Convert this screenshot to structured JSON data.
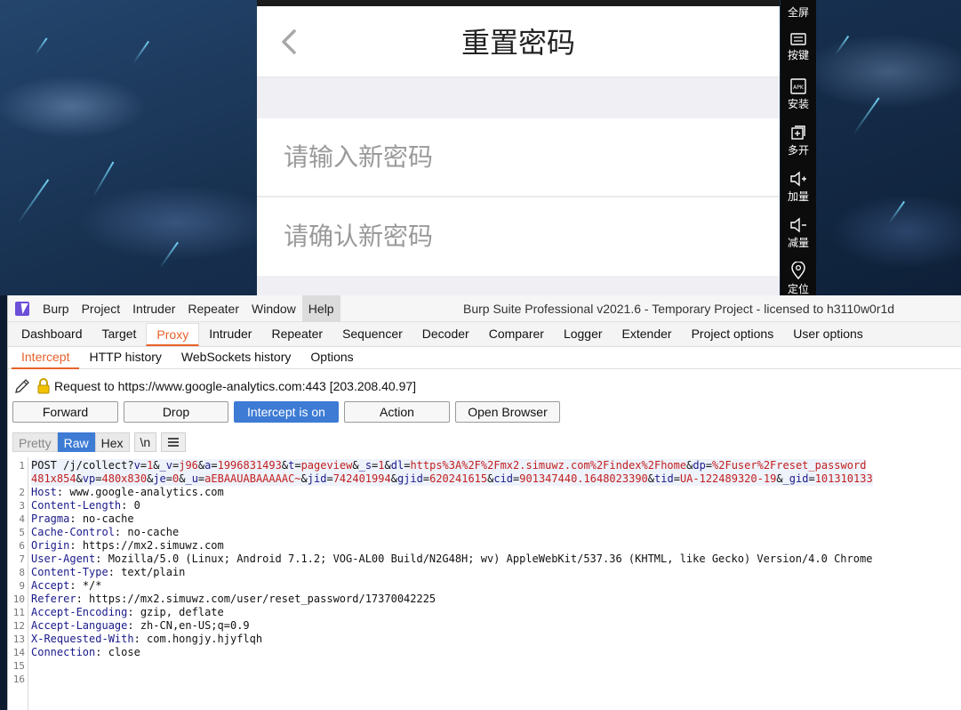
{
  "phone": {
    "title": "重置密码",
    "new_password_placeholder": "请输入新密码",
    "confirm_password_placeholder": "请确认新密码"
  },
  "emulator_toolbar": {
    "items": [
      {
        "label": "全屏",
        "icon": "fullscreen-icon"
      },
      {
        "label": "按键",
        "icon": "keyboard-icon"
      },
      {
        "label": "安装",
        "icon": "apk-icon"
      },
      {
        "label": "多开",
        "icon": "multi-instance-icon"
      },
      {
        "label": "加量",
        "icon": "volume-up-icon"
      },
      {
        "label": "减量",
        "icon": "volume-down-icon"
      },
      {
        "label": "定位",
        "icon": "location-icon"
      }
    ]
  },
  "burp": {
    "menu": [
      "Burp",
      "Project",
      "Intruder",
      "Repeater",
      "Window",
      "Help"
    ],
    "window_title": "Burp Suite Professional v2021.6 - Temporary Project - licensed to h3110w0r1d",
    "tabs": [
      "Dashboard",
      "Target",
      "Proxy",
      "Intruder",
      "Repeater",
      "Sequencer",
      "Decoder",
      "Comparer",
      "Logger",
      "Extender",
      "Project options",
      "User options"
    ],
    "active_tab": "Proxy",
    "subtabs": [
      "Intercept",
      "HTTP history",
      "WebSockets history",
      "Options"
    ],
    "active_subtab": "Intercept",
    "request_label": "Request to https://www.google-analytics.com:443  [203.208.40.97]",
    "buttons": {
      "forward": "Forward",
      "drop": "Drop",
      "intercept": "Intercept is on",
      "action": "Action",
      "open_browser": "Open Browser"
    },
    "view_tabs": [
      "Pretty",
      "Raw",
      "Hex"
    ],
    "active_view": "Raw",
    "newline_toggle": "\\n",
    "line_numbers": [
      "1",
      "2",
      "3",
      "4",
      "5",
      "6",
      "7",
      "8",
      "9",
      "10",
      "11",
      "12",
      "13",
      "14",
      "15",
      "16"
    ],
    "request_line_1": {
      "method": "POST /j/collect?",
      "params": [
        [
          "v",
          "1"
        ],
        [
          "_v",
          "j96"
        ],
        [
          "a",
          "1996831493"
        ],
        [
          "t",
          "pageview"
        ],
        [
          "_s",
          "1"
        ],
        [
          "dl",
          "https%3A%2F%2Fmx2.simuwz.com%2Findex%2Fhome"
        ],
        [
          "dp",
          "%2Fuser%2Freset_password"
        ]
      ]
    },
    "request_line_1_wrap": {
      "prefix": "481x854",
      "params": [
        [
          "vp",
          "480x830"
        ],
        [
          "je",
          "0"
        ],
        [
          "_u",
          "aEBAAUABAAAAAC~"
        ],
        [
          "jid",
          "742401994"
        ],
        [
          "gjid",
          "620241615"
        ],
        [
          "cid",
          "901347440.1648023390"
        ],
        [
          "tid",
          "UA-122489320-19"
        ],
        [
          "_gid",
          "101310133"
        ]
      ]
    },
    "headers": [
      {
        "name": "Host",
        "value": "www.google-analytics.com"
      },
      {
        "name": "Content-Length",
        "value": "0"
      },
      {
        "name": "Pragma",
        "value": "no-cache"
      },
      {
        "name": "Cache-Control",
        "value": "no-cache"
      },
      {
        "name": "Origin",
        "value": "https://mx2.simuwz.com"
      },
      {
        "name": "User-Agent",
        "value": "Mozilla/5.0 (Linux; Android 7.1.2; VOG-AL00 Build/N2G48H; wv) AppleWebKit/537.36 (KHTML, like Gecko) Version/4.0 Chrome"
      },
      {
        "name": "Content-Type",
        "value": "text/plain"
      },
      {
        "name": "Accept",
        "value": "*/*"
      },
      {
        "name": "Referer",
        "value": "https://mx2.simuwz.com/user/reset_password/17370042225"
      },
      {
        "name": "Accept-Encoding",
        "value": "gzip, deflate"
      },
      {
        "name": "Accept-Language",
        "value": "zh-CN,en-US;q=0.9"
      },
      {
        "name": "X-Requested-With",
        "value": "com.hongjy.hjyflqh"
      },
      {
        "name": "Connection",
        "value": "close"
      }
    ]
  }
}
